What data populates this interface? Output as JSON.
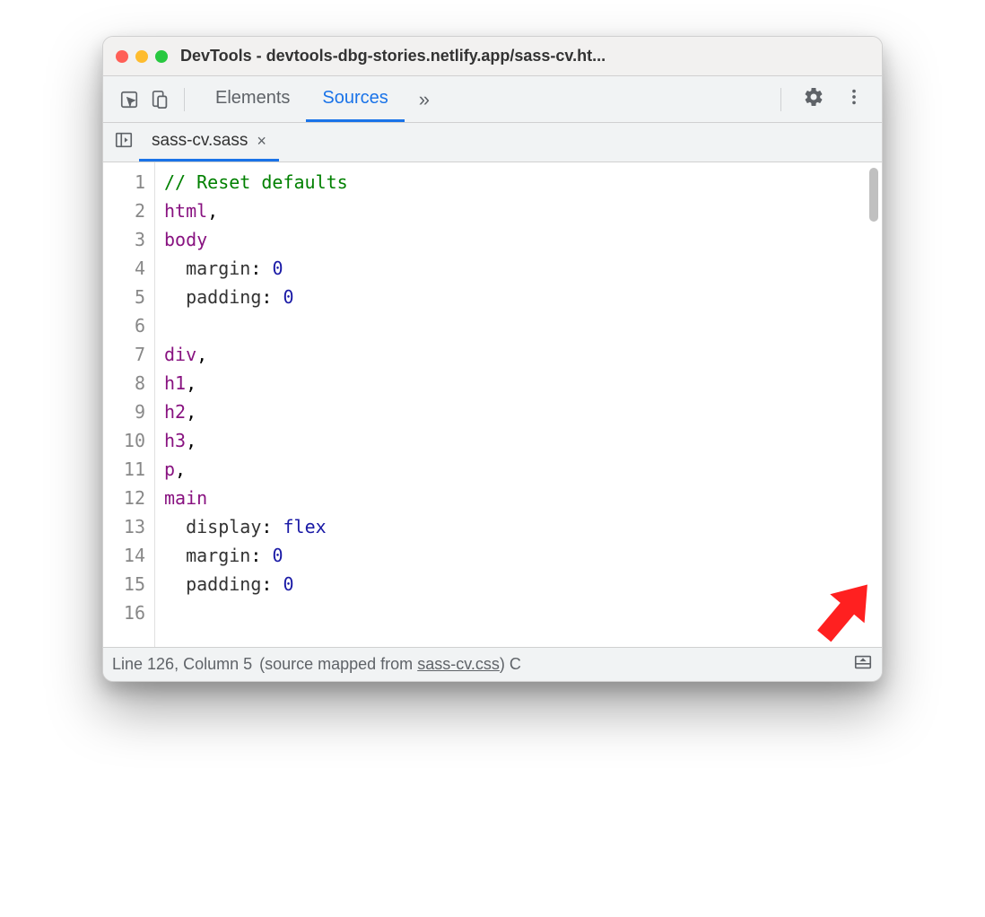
{
  "window": {
    "title": "DevTools - devtools-dbg-stories.netlify.app/sass-cv.ht..."
  },
  "tabs": {
    "elements": "Elements",
    "sources": "Sources"
  },
  "file_tab": {
    "name": "sass-cv.sass",
    "close": "×"
  },
  "code": {
    "lines": [
      {
        "n": 1,
        "segments": [
          {
            "t": "// Reset defaults",
            "c": "c-comment"
          }
        ]
      },
      {
        "n": 2,
        "segments": [
          {
            "t": "html",
            "c": "c-tag"
          },
          {
            "t": ",",
            "c": ""
          }
        ]
      },
      {
        "n": 3,
        "segments": [
          {
            "t": "body",
            "c": "c-tag"
          }
        ]
      },
      {
        "n": 4,
        "segments": [
          {
            "t": "  ",
            "c": ""
          },
          {
            "t": "margin",
            "c": "c-prop"
          },
          {
            "t": ": ",
            "c": ""
          },
          {
            "t": "0",
            "c": "c-val-num"
          }
        ]
      },
      {
        "n": 5,
        "segments": [
          {
            "t": "  ",
            "c": ""
          },
          {
            "t": "padding",
            "c": "c-prop"
          },
          {
            "t": ": ",
            "c": ""
          },
          {
            "t": "0",
            "c": "c-val-num"
          }
        ]
      },
      {
        "n": 6,
        "segments": [
          {
            "t": "",
            "c": ""
          }
        ]
      },
      {
        "n": 7,
        "segments": [
          {
            "t": "div",
            "c": "c-tag"
          },
          {
            "t": ",",
            "c": ""
          }
        ]
      },
      {
        "n": 8,
        "segments": [
          {
            "t": "h1",
            "c": "c-tag"
          },
          {
            "t": ",",
            "c": ""
          }
        ]
      },
      {
        "n": 9,
        "segments": [
          {
            "t": "h2",
            "c": "c-tag"
          },
          {
            "t": ",",
            "c": ""
          }
        ]
      },
      {
        "n": 10,
        "segments": [
          {
            "t": "h3",
            "c": "c-tag"
          },
          {
            "t": ",",
            "c": ""
          }
        ]
      },
      {
        "n": 11,
        "segments": [
          {
            "t": "p",
            "c": "c-tag"
          },
          {
            "t": ",",
            "c": ""
          }
        ]
      },
      {
        "n": 12,
        "segments": [
          {
            "t": "main",
            "c": "c-tag"
          }
        ]
      },
      {
        "n": 13,
        "segments": [
          {
            "t": "  ",
            "c": ""
          },
          {
            "t": "display",
            "c": "c-prop"
          },
          {
            "t": ": ",
            "c": ""
          },
          {
            "t": "flex",
            "c": "c-val-kw"
          }
        ]
      },
      {
        "n": 14,
        "segments": [
          {
            "t": "  ",
            "c": ""
          },
          {
            "t": "margin",
            "c": "c-prop"
          },
          {
            "t": ": ",
            "c": ""
          },
          {
            "t": "0",
            "c": "c-val-num"
          }
        ]
      },
      {
        "n": 15,
        "segments": [
          {
            "t": "  ",
            "c": ""
          },
          {
            "t": "padding",
            "c": "c-prop"
          },
          {
            "t": ": ",
            "c": ""
          },
          {
            "t": "0",
            "c": "c-val-num"
          }
        ]
      },
      {
        "n": 16,
        "segments": [
          {
            "t": "",
            "c": ""
          }
        ]
      }
    ]
  },
  "status": {
    "position": "Line 126, Column 5",
    "mapped_prefix": "(source mapped from ",
    "mapped_link": "sass-cv.css",
    "mapped_suffix": ")",
    "cut": " C"
  }
}
